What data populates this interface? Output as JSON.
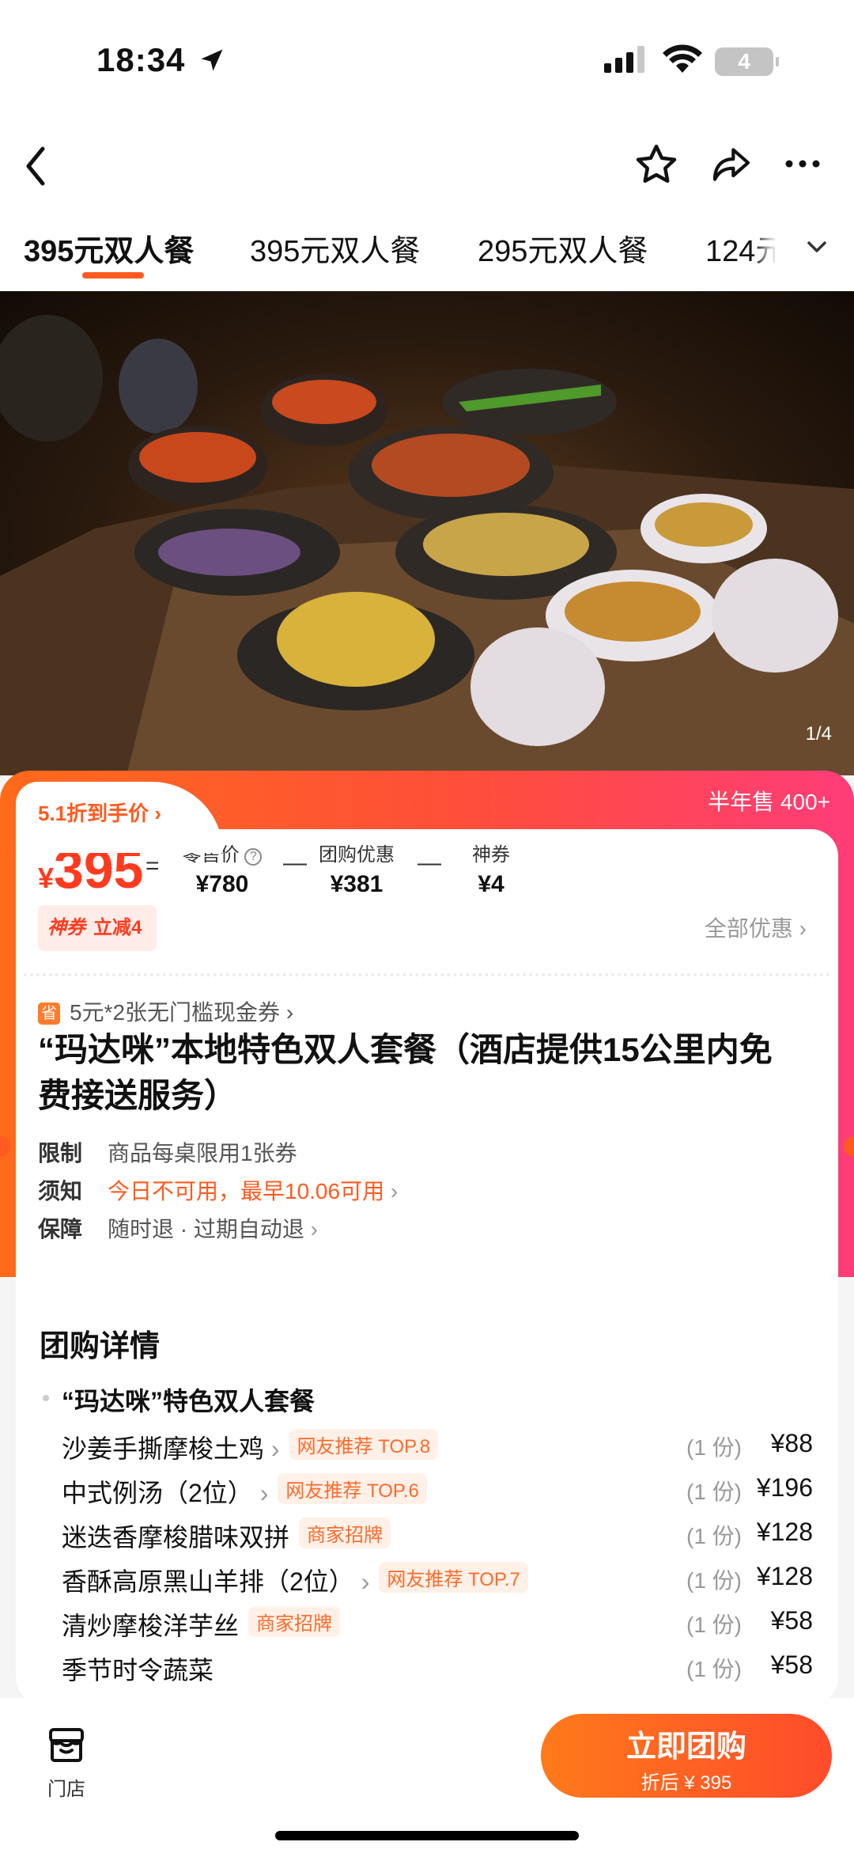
{
  "status_bar": {
    "time": "18:34",
    "battery": "4"
  },
  "tabs": [
    "395元双人餐",
    "395元双人餐",
    "295元双人餐",
    "124元"
  ],
  "hero": {
    "counter": "1/4"
  },
  "price_card": {
    "half_year_sales": "半年售 400+",
    "discount_label": "5.1折到手价",
    "currency": "¥",
    "price": "395",
    "equals": "=",
    "minus": "—",
    "retail_label": "零售价",
    "retail_value": "¥780",
    "group_label": "团购优惠",
    "group_value": "¥381",
    "coupon_label": "神券",
    "coupon_value": "¥4",
    "shenquan_brand": "神券",
    "shenquan_text": "立减4",
    "all_discounts": "全部优惠"
  },
  "coupon_line": {
    "badge": "省",
    "text": "5元*2张无门槛现金券"
  },
  "deal_title": "“玛达咪”本地特色双人套餐（酒店提供15公里内免费接送服务）",
  "info": [
    {
      "key": "限制",
      "value": "商品每桌限用1张券"
    },
    {
      "key": "须知",
      "value": "今日不可用，最早10.06可用"
    },
    {
      "key": "保障",
      "value": "随时退 · 过期自动退"
    }
  ],
  "detail": {
    "heading": "团购详情",
    "package_name": "“玛达咪”特色双人套餐",
    "items": [
      {
        "name": "沙姜手撕摩梭土鸡",
        "tag": "网友推荐 TOP.8",
        "qty": "(1 份)",
        "price": "¥88"
      },
      {
        "name": "中式例汤（2位）",
        "tag": "网友推荐 TOP.6",
        "qty": "(1 份)",
        "price": "¥196"
      },
      {
        "name": "迷迭香摩梭腊味双拼",
        "tag": "商家招牌",
        "qty": "(1 份)",
        "price": "¥128"
      },
      {
        "name": "香酥高原黑山羊排（2位）",
        "tag": "网友推荐 TOP.7",
        "qty": "(1 份)",
        "price": "¥128"
      },
      {
        "name": "清炒摩梭洋芋丝",
        "tag": "商家招牌",
        "qty": "(1 份)",
        "price": "¥58"
      },
      {
        "name": "季节时令蔬菜",
        "tag": "",
        "qty": "(1 份)",
        "price": "¥58"
      }
    ]
  },
  "bottom_bar": {
    "store_label": "门店",
    "buy_label": "立即团购",
    "buy_sub": "折后 ¥ 395"
  },
  "colors": {
    "accent": "#ff5a1f",
    "gradient_end": "#ff3c78"
  }
}
